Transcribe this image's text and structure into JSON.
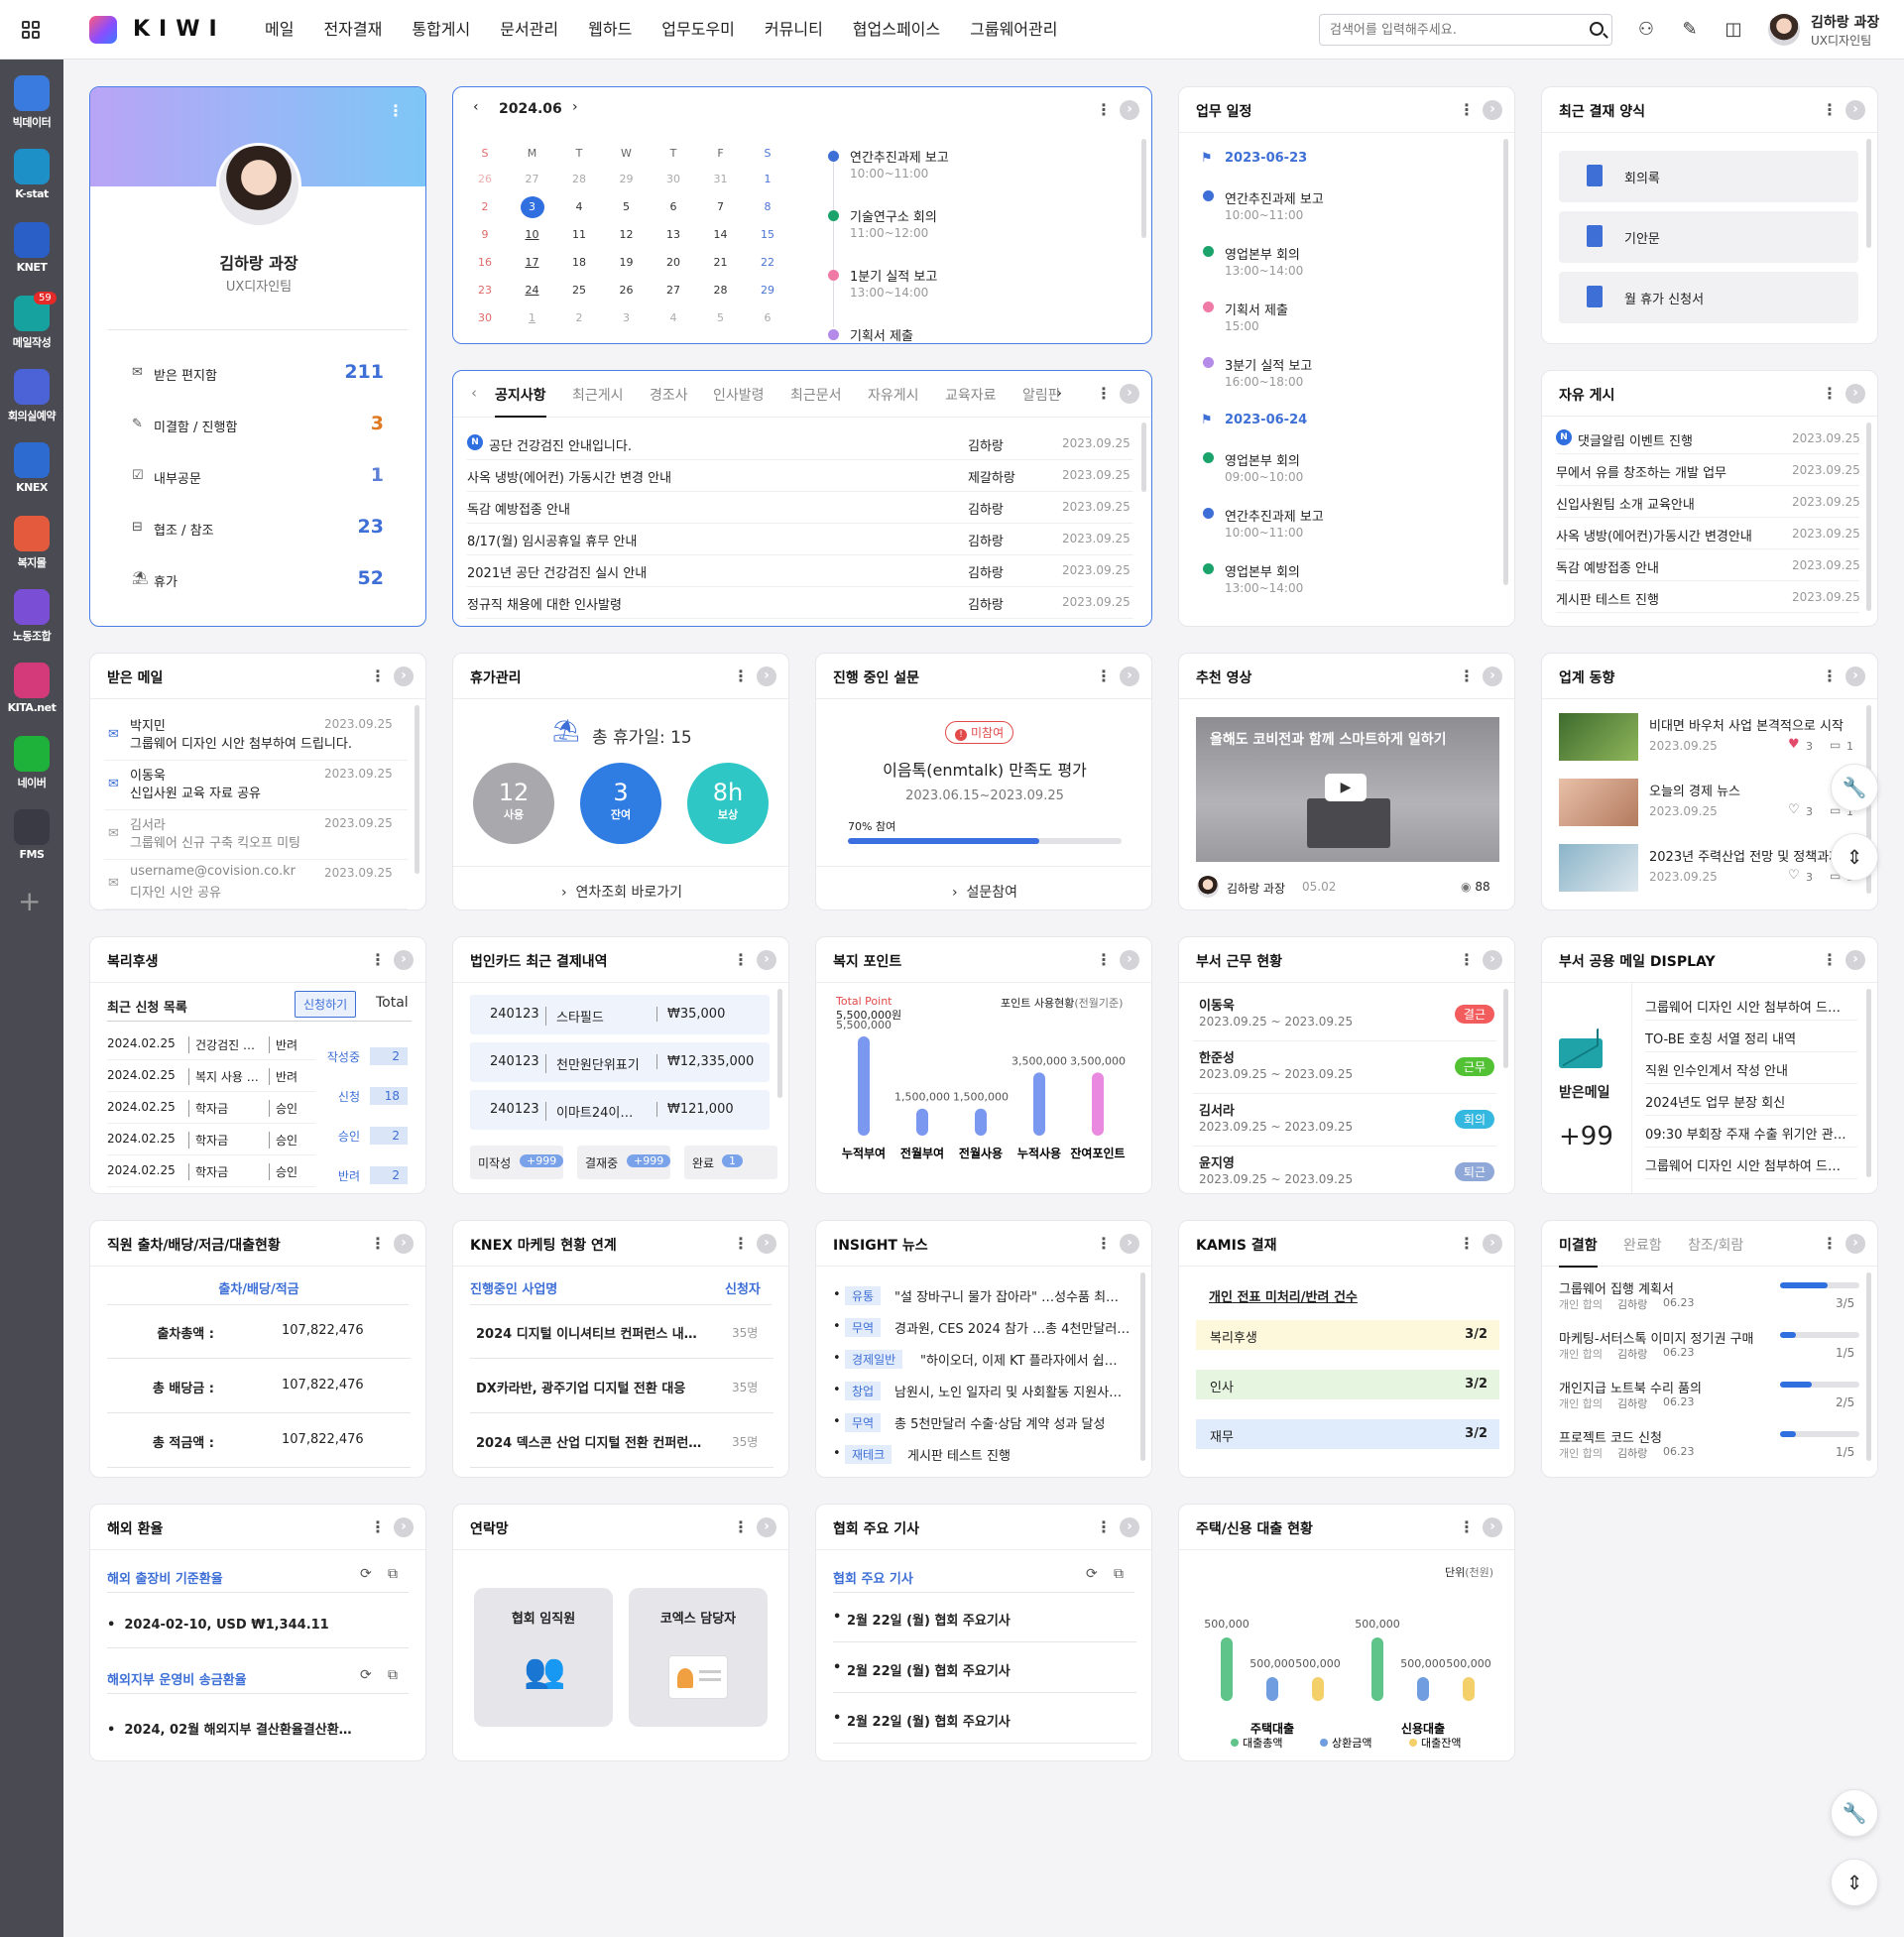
{
  "app": {
    "logo_text": "KIWI",
    "nav": [
      "메일",
      "전자결재",
      "통합게시",
      "문서관리",
      "웹하드",
      "업무도우미",
      "커뮤니티",
      "협업스페이스",
      "그룹웨어관리"
    ],
    "search_placeholder": "검색어를 입력해주세요.",
    "user_name": "김하랑 과장",
    "user_dept": "UX디자인팀"
  },
  "sidebar": [
    {
      "label": "빅데이터",
      "color": "#3a7be0"
    },
    {
      "label": "K-stat",
      "color": "#1e90c8"
    },
    {
      "label": "KNET",
      "color": "#2a5fc7"
    },
    {
      "label": "메일작성",
      "color": "#16a3a0",
      "badge": "59"
    },
    {
      "label": "회의실예약",
      "color": "#4b63d6"
    },
    {
      "label": "KNEX",
      "color": "#2d6bd0"
    },
    {
      "label": "복지몰",
      "color": "#e35a3c"
    },
    {
      "label": "노동조합",
      "color": "#7a4fd6"
    },
    {
      "label": "KITA.net",
      "color": "#d43a7a"
    },
    {
      "label": "네이버",
      "color": "#1fb23a"
    },
    {
      "label": "FMS",
      "color": "#3a3a44"
    }
  ],
  "profile": {
    "name": "김하랑 과장",
    "dept": "UX디자인팀",
    "stats": [
      {
        "label": "받은 편지함",
        "value": "211",
        "color": "#3d6fd6",
        "icon": "mailbox-icon"
      },
      {
        "label": "미결함 / 진행함",
        "value": "3",
        "color": "#e07a22",
        "icon": "pencil-icon"
      },
      {
        "label": "내부공문",
        "value": "1",
        "color": "#5d7fd6",
        "icon": "clipboard-icon"
      },
      {
        "label": "협조 / 참조",
        "value": "23",
        "color": "#3d6fd6",
        "icon": "tray-icon"
      },
      {
        "label": "휴가",
        "value": "52",
        "color": "#3d6fd6",
        "icon": "vacation-icon"
      }
    ]
  },
  "calendar": {
    "month": "2024.06",
    "weekdays": [
      "S",
      "M",
      "T",
      "W",
      "T",
      "F",
      "S"
    ],
    "rows": [
      [
        "26",
        "27",
        "28",
        "29",
        "30",
        "31",
        "1"
      ],
      [
        "2",
        "3",
        "4",
        "5",
        "6",
        "7",
        "8"
      ],
      [
        "9",
        "10",
        "11",
        "12",
        "13",
        "14",
        "15"
      ],
      [
        "16",
        "17",
        "18",
        "19",
        "20",
        "21",
        "22"
      ],
      [
        "23",
        "24",
        "25",
        "26",
        "27",
        "28",
        "29"
      ],
      [
        "30",
        "1",
        "2",
        "3",
        "4",
        "5",
        "6"
      ]
    ],
    "today": "3",
    "events": [
      {
        "title": "연간추진과제 보고",
        "time": "10:00~11:00",
        "color": "#3d6fd6"
      },
      {
        "title": "기술연구소 회의",
        "time": "11:00~12:00",
        "color": "#1aa36a"
      },
      {
        "title": "1분기 실적 보고",
        "time": "13:00~14:00",
        "color": "#ef7aa6"
      },
      {
        "title": "기획서 제출",
        "time": "",
        "color": "#b48be8"
      }
    ]
  },
  "notice": {
    "tabs": [
      "공지사항",
      "최근게시",
      "경조사",
      "인사발령",
      "최근문서",
      "자유게시",
      "교육자료",
      "알림판"
    ],
    "rows": [
      {
        "title": "공단 건강검진 안내입니다.",
        "author": "김하랑",
        "date": "2023.09.25",
        "new": true
      },
      {
        "title": "사옥 냉방(에어컨) 가동시간 변경 안내",
        "author": "제갈하랑",
        "date": "2023.09.25"
      },
      {
        "title": "독감 예방접종 안내",
        "author": "김하랑",
        "date": "2023.09.25"
      },
      {
        "title": "8/17(월) 임시공휴일 휴무 안내",
        "author": "김하랑",
        "date": "2023.09.25"
      },
      {
        "title": "2021년 공단 건강검진 실시 안내",
        "author": "김하랑",
        "date": "2023.09.25"
      },
      {
        "title": "정규직 채용에 대한 인사발령",
        "author": "김하랑",
        "date": "2023.09.25"
      }
    ]
  },
  "schedule": {
    "title": "업무 일정",
    "groups": [
      {
        "date": "2023-06-23",
        "items": [
          {
            "title": "연간추진과제 보고",
            "time": "10:00~11:00",
            "color": "#3d6fd6"
          },
          {
            "title": "영업본부 회의",
            "time": "13:00~14:00",
            "color": "#1aa36a"
          },
          {
            "title": "기획서 제출",
            "time": "15:00",
            "color": "#ef7aa6"
          },
          {
            "title": "3분기 실적 보고",
            "time": "16:00~18:00",
            "color": "#b48be8"
          }
        ]
      },
      {
        "date": "2023-06-24",
        "items": [
          {
            "title": "영업본부 회의",
            "time": "09:00~10:00",
            "color": "#1aa36a"
          },
          {
            "title": "연간추진과제 보고",
            "time": "10:00~11:00",
            "color": "#3d6fd6"
          },
          {
            "title": "영업본부 회의",
            "time": "13:00~14:00",
            "color": "#1aa36a"
          }
        ]
      }
    ]
  },
  "recent_forms": {
    "title": "최근 결재 양식",
    "items": [
      "회의록",
      "기안문",
      "월 휴가 신청서"
    ]
  },
  "free_board": {
    "title": "자유 게시",
    "rows": [
      {
        "title": "댓글알림 이벤트 진행",
        "date": "2023.09.25",
        "new": true
      },
      {
        "title": "무에서 유를 창조하는 개발 업무",
        "date": "2023.09.25"
      },
      {
        "title": "신입사원팀 소개 교육안내",
        "date": "2023.09.25"
      },
      {
        "title": "사옥 냉방(에어컨)가동시간 변경안내",
        "date": "2023.09.25"
      },
      {
        "title": "독감 예방접종 안내",
        "date": "2023.09.25"
      },
      {
        "title": "게시판 테스트 진행",
        "date": "2023.09.25"
      }
    ]
  },
  "inbox": {
    "title": "받은 메일",
    "rows": [
      {
        "from": "박지민",
        "subject": "그룹웨어 디자인 시안 첨부하여 드립니다.",
        "date": "2023.09.25",
        "read": false
      },
      {
        "from": "이동욱",
        "subject": "신입사원 교육 자료 공유",
        "date": "2023.09.25",
        "read": false
      },
      {
        "from": "김서라",
        "subject": "그룹웨어 신규 구축 킥오프 미팅",
        "date": "2023.09.25",
        "read": true
      },
      {
        "from": "username@covision.co.kr",
        "subject": "디자인 시안 공유",
        "date": "2023.09.25",
        "read": true
      }
    ]
  },
  "vacation": {
    "title": "휴가관리",
    "total": "총 휴가일: 15",
    "circles": [
      {
        "value": "12",
        "label": "사용",
        "color": "#a8a8ad"
      },
      {
        "value": "3",
        "label": "잔여",
        "color": "#2f7de2"
      },
      {
        "value": "8h",
        "label": "보상",
        "color": "#2fc6c6"
      }
    ],
    "link": "연차조회 바로가기"
  },
  "survey": {
    "title": "진행 중인 설문",
    "badge": "미참여",
    "name": "이음톡(enmtalk) 만족도 평가",
    "period": "2023.06.15~2023.09.25",
    "progress_label": "70% 참여",
    "progress": 0.7,
    "link": "설문참여"
  },
  "video": {
    "title": "추천 영상",
    "caption": "올해도 코비전과 함께 스마트하게 일하기",
    "author": "김하랑 과장",
    "date": "05.02",
    "views": "88"
  },
  "industry": {
    "title": "업계 동향",
    "items": [
      {
        "title": "비대면 바우처 사업 본격적으로 시작",
        "date": "2023.09.25",
        "likes": "3",
        "comments": "1",
        "liked": true
      },
      {
        "title": "오늘의 경제 뉴스",
        "date": "2023.09.25",
        "likes": "3",
        "comments": "1",
        "liked": false
      },
      {
        "title": "2023년 주력산업 전망 및 정책과제",
        "date": "2023.09.25",
        "likes": "3",
        "comments": "1",
        "liked": false
      }
    ]
  },
  "welfare": {
    "title": "복리후생",
    "sub": "최근 신청 목록",
    "apply_btn": "신청하기",
    "total_label": "Total",
    "rows": [
      {
        "date": "2024.02.25",
        "type": "건강검진 신청",
        "status": "반려"
      },
      {
        "date": "2024.02.25",
        "type": "복지 사용 신…",
        "status": "반려"
      },
      {
        "date": "2024.02.25",
        "type": "학자금",
        "status": "승인"
      },
      {
        "date": "2024.02.25",
        "type": "학자금",
        "status": "승인"
      },
      {
        "date": "2024.02.25",
        "type": "학자금",
        "status": "승인"
      }
    ],
    "summary": [
      {
        "label": "작성중",
        "value": "2"
      },
      {
        "label": "신청",
        "value": "18"
      },
      {
        "label": "승인",
        "value": "2"
      },
      {
        "label": "반려",
        "value": "2"
      }
    ]
  },
  "card": {
    "title": "법인카드 최근 결제내역",
    "rows": [
      {
        "date": "240123",
        "store": "스타필드",
        "amount": "₩35,000"
      },
      {
        "date": "240123",
        "store": "천만원단위표기",
        "amount": "₩12,335,000"
      },
      {
        "date": "240123",
        "store": "이마트24이마…",
        "amount": "₩121,000"
      }
    ],
    "status": [
      {
        "label": "미작성",
        "value": "+999"
      },
      {
        "label": "결재중",
        "value": "+999"
      },
      {
        "label": "완료",
        "value": "1"
      }
    ]
  },
  "points": {
    "title": "복지 포인트",
    "total_label": "Total Point",
    "total_value": "5,500,000원",
    "usage_label": "포인트 사용현황",
    "usage_sub": "(전월기준)",
    "chart_data": {
      "type": "bar",
      "categories": [
        "누적부여",
        "전월부여",
        "전월사용",
        "누적사용",
        "잔여포인트"
      ],
      "values": [
        5500000,
        1500000,
        1500000,
        3500000,
        3500000
      ],
      "labels": [
        "5,500,000",
        "1,500,000",
        "1,500,000",
        "3,500,000",
        "3,500,000"
      ],
      "colors": [
        "#7b98f0",
        "#7b98f0",
        "#7b98f0",
        "#7b98f0",
        "#e98ae0"
      ]
    }
  },
  "attendance": {
    "title": "부서 근무 현황",
    "rows": [
      {
        "name": "이동욱",
        "period": "2023.09.25 ~ 2023.09.25",
        "status": "결근",
        "color": "#f25c5c"
      },
      {
        "name": "한준성",
        "period": "2023.09.25 ~ 2023.09.25",
        "status": "근무",
        "color": "#52c234"
      },
      {
        "name": "김서라",
        "period": "2023.09.25 ~ 2023.09.25",
        "status": "회의",
        "color": "#34b8e0"
      },
      {
        "name": "윤지영",
        "period": "2023.09.25 ~ 2023.09.25",
        "status": "퇴근",
        "color": "#8fa8d8"
      }
    ]
  },
  "shared_mail": {
    "title": "부서 공용 메일 DISPLAY",
    "label": "받은메일",
    "count": "+99",
    "items": [
      "그룹웨어 디자인 시안 첨부하여 드…",
      "TO-BE 호칭 서열 정리 내역",
      "직원 인수인계서 작성 안내",
      "2024년도 업무 분장 회신",
      "09:30 부회장 주재 수출 위기안 관…",
      "그룹웨어 디자인 시안 첨부하여 드…"
    ]
  },
  "loan": {
    "title": "직원 출차/배당/저금/대출현황",
    "header": "출차/배당/적금",
    "rows": [
      {
        "label": "출차총액 :",
        "value": "107,822,476"
      },
      {
        "label": "총 배당금 :",
        "value": "107,822,476"
      },
      {
        "label": "총 적금액 :",
        "value": "107,822,476"
      }
    ]
  },
  "knex": {
    "title": "KNEX 마케팅 현황 연계",
    "col1": "진행중인 사업명",
    "col2": "신청자",
    "rows": [
      {
        "name": "2024 디지털 이니셔티브 컨퍼런스 내…",
        "count": "35명"
      },
      {
        "name": "DX카라반, 광주기업 디지털 전환 대응",
        "count": "35명"
      },
      {
        "name": "2024 덱스콘 산업 디지털 전환 컨퍼런…",
        "count": "35명"
      }
    ]
  },
  "insight": {
    "title": "INSIGHT 뉴스",
    "rows": [
      {
        "tag": "유통",
        "text": "\"설 장바구니 물가 잡아라\" …성수품 최…"
      },
      {
        "tag": "무역",
        "text": "경과원, CES 2024 참가 …총 4천만달러 …"
      },
      {
        "tag": "경제일반",
        "text": "\"하이오더, 이제 KT 플라자에서 쉽…"
      },
      {
        "tag": "창업",
        "text": "남원시, 노인 일자리 및 사회활동 지원사…"
      },
      {
        "tag": "무역",
        "text": "총 5천만달러 수출·상담 계약 성과 달성"
      },
      {
        "tag": "재테크",
        "text": "게시판 테스트 진행"
      }
    ]
  },
  "kamis": {
    "title": "KAMIS 결재",
    "sub": "개인 전표 미처리/반려 건수",
    "rows": [
      {
        "label": "복리후생",
        "value": "3/2",
        "bg": "#fdf8dc"
      },
      {
        "label": "인사",
        "value": "3/2",
        "bg": "#e6f5df"
      },
      {
        "label": "재무",
        "value": "3/2",
        "bg": "#e0ecfb"
      }
    ]
  },
  "pending": {
    "tabs": [
      "미결함",
      "완료함",
      "참조/회람"
    ],
    "rows": [
      {
        "title": "그룹웨어 집행 계획서",
        "meta": "개인 합의",
        "author": "김하랑",
        "date": "06.23",
        "progress": 0.6,
        "count": "3/5"
      },
      {
        "title": "마케팅-서터스톡 이미지 정기권 구매",
        "meta": "개인 합의",
        "author": "김하랑",
        "date": "06.23",
        "progress": 0.2,
        "count": "1/5"
      },
      {
        "title": "개인지급 노트북 수리 품의",
        "meta": "개인 합의",
        "author": "김하랑",
        "date": "06.23",
        "progress": 0.4,
        "count": "2/5"
      },
      {
        "title": "프로젝트 코드 신청",
        "meta": "개인 합의",
        "author": "김하랑",
        "date": "06.23",
        "progress": 0.2,
        "count": "1/5"
      }
    ]
  },
  "exchange": {
    "title": "해외 환율",
    "sec1": "해외 출장비 기준환율",
    "row1": "2024-02-10, USD  ₩1,344.11",
    "sec2": "해외지부 운영비 송금환율",
    "row2": "2024, 02월 해외지부 결산환율결산환…"
  },
  "contacts": {
    "title": "연락망",
    "items": [
      "협회 임직원",
      "코엑스 담당자"
    ]
  },
  "articles": {
    "title": "협회 주요 기사",
    "sec": "협회 주요 기사",
    "rows": [
      "2월 22일 (월) 협회 주요기사",
      "2월 22일 (월) 협회 주요기사",
      "2월 22일 (월) 협회 주요기사"
    ]
  },
  "housing": {
    "title": "주택/신용 대출 현황",
    "unit": "단위",
    "unit_sub": "(천원)",
    "chart_data": {
      "type": "bar",
      "categories": [
        "주택대출",
        "신용대출"
      ],
      "series": [
        {
          "name": "대출총액",
          "values": [
            500000,
            500000
          ],
          "color": "#5fc48a"
        },
        {
          "name": "상환금액",
          "values": [
            500000,
            500000
          ],
          "color": "#6f9de0"
        },
        {
          "name": "대출잔액",
          "values": [
            500000,
            500000
          ],
          "color": "#f4d06a"
        }
      ],
      "labels": [
        "500,000",
        "500,000",
        "500,000"
      ]
    }
  }
}
